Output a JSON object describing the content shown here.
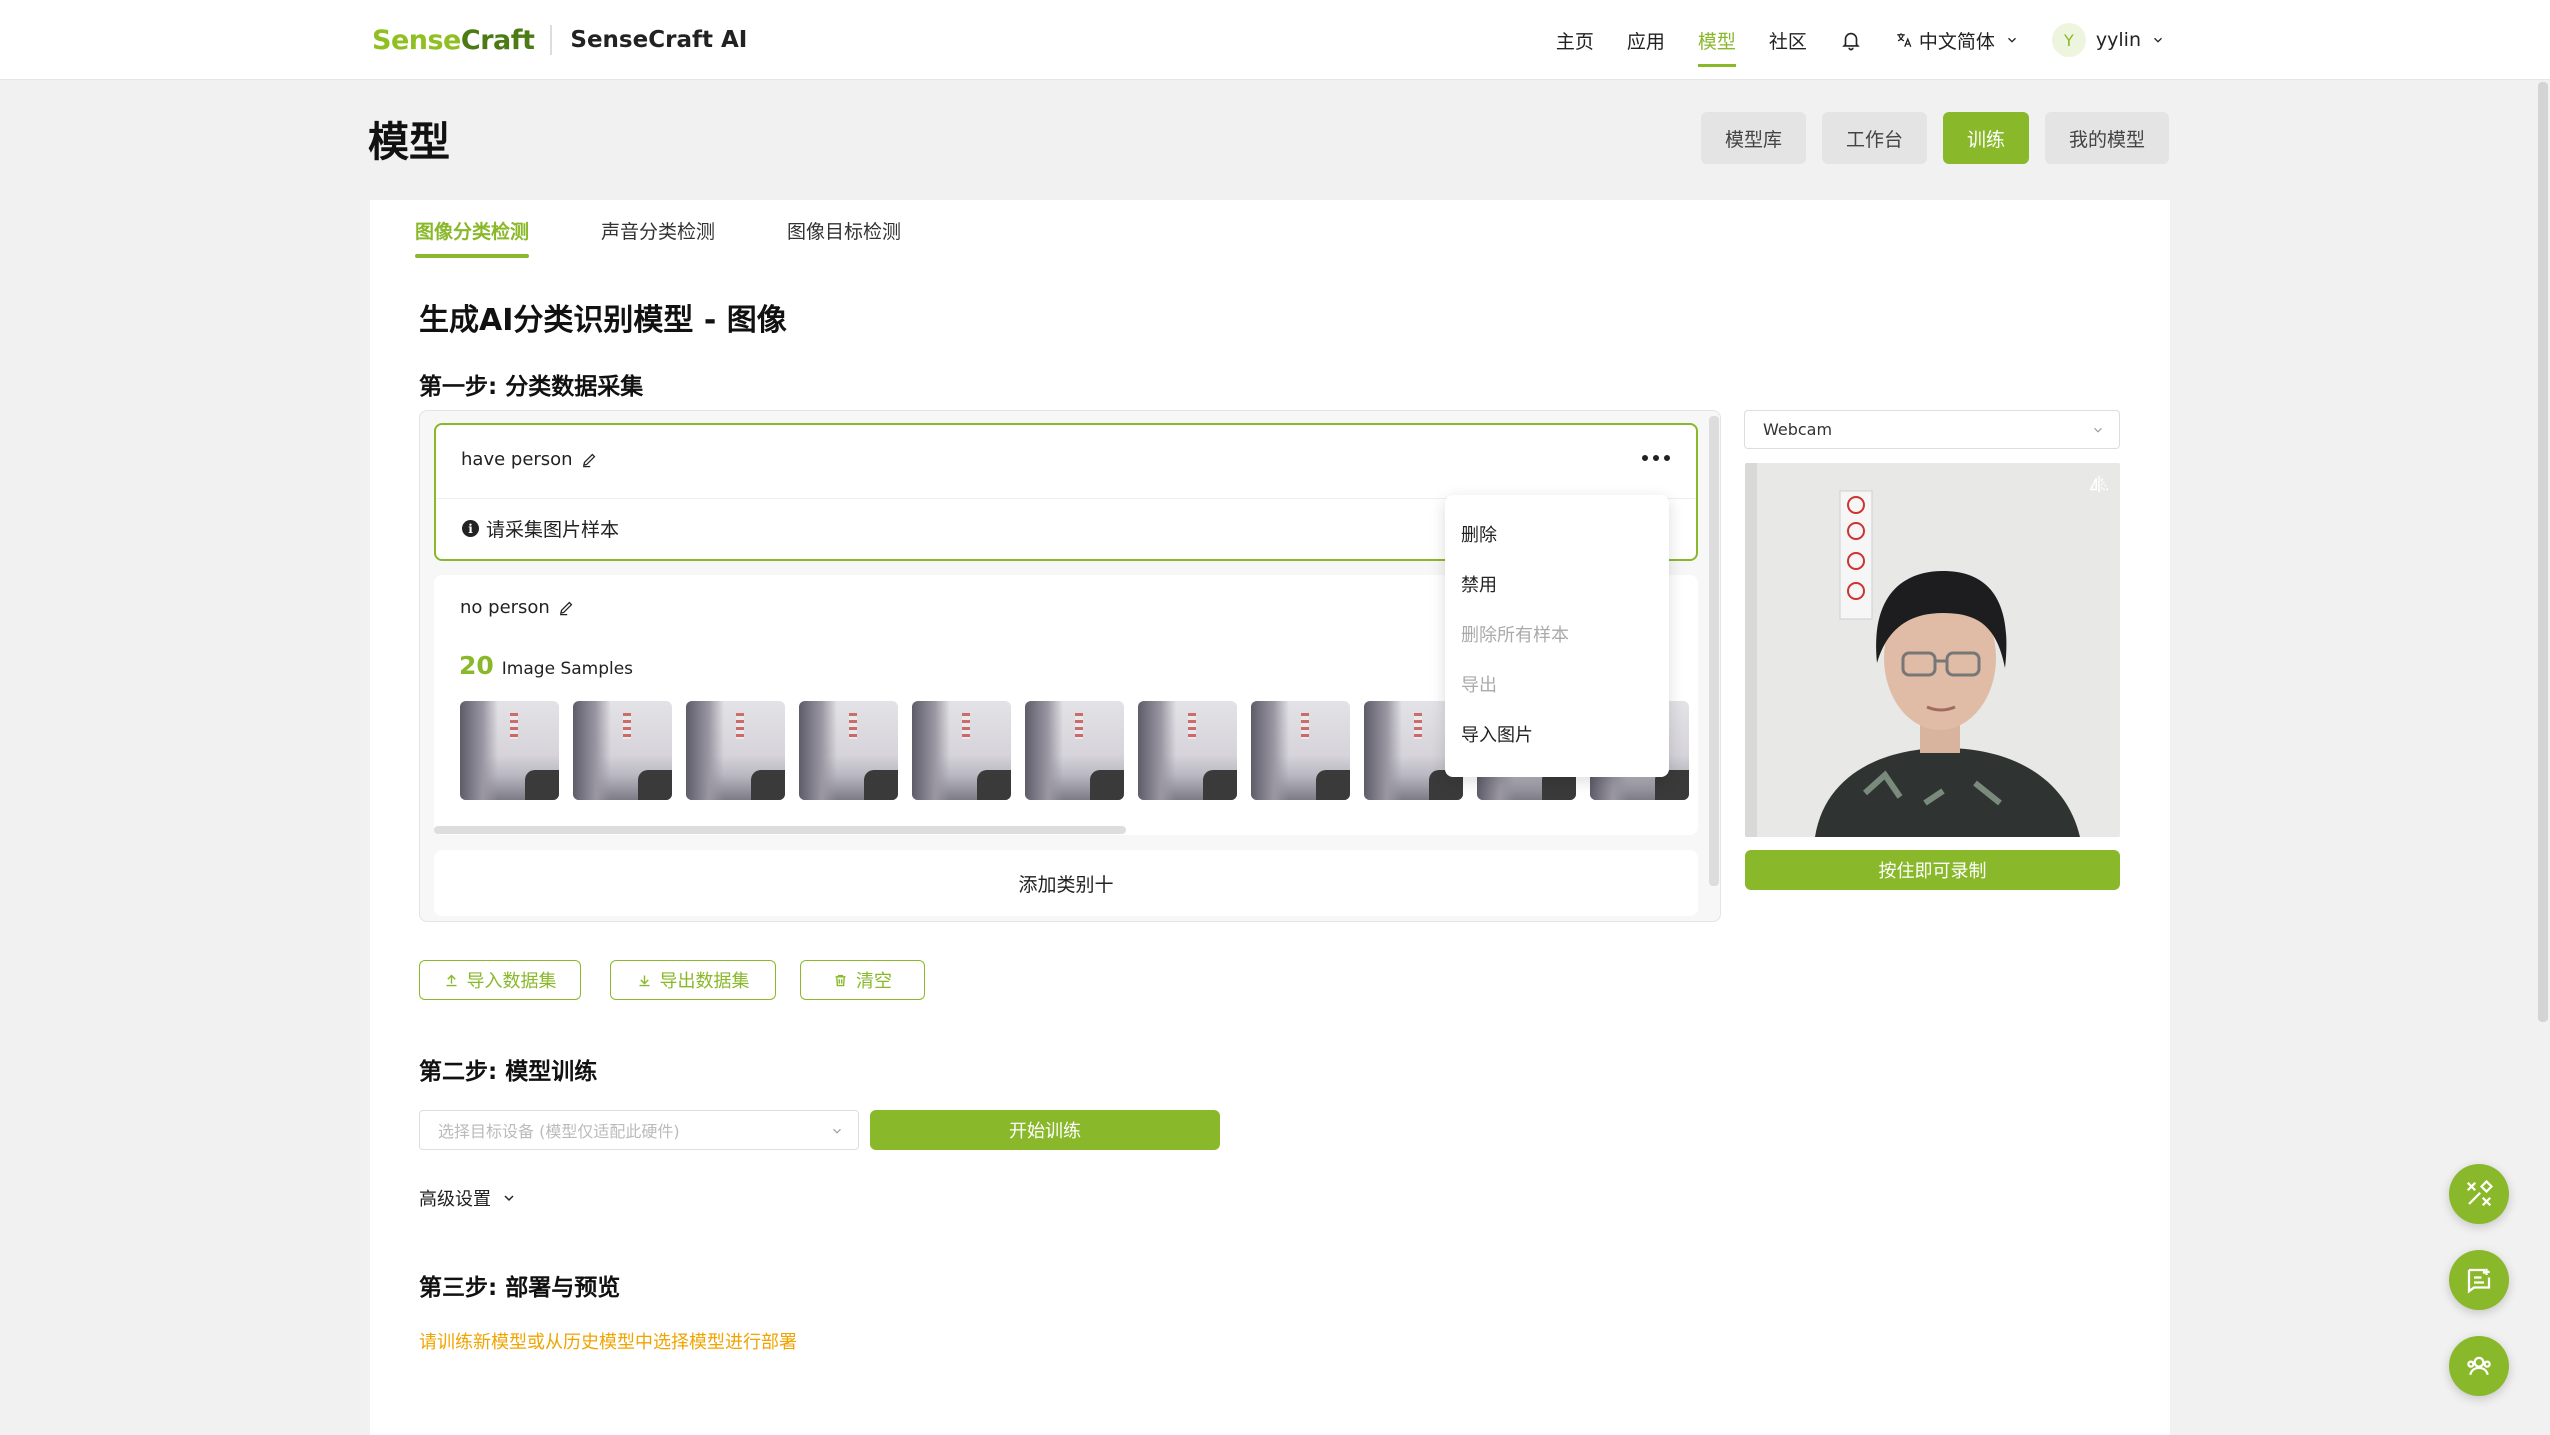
{
  "header": {
    "logo": {
      "part1": "Sense",
      "part2": "Craft"
    },
    "app_name": "SenseCraft AI",
    "nav": [
      "主页",
      "应用",
      "模型",
      "社区"
    ],
    "active_nav": "模型",
    "language": "中文简体",
    "user": {
      "initial": "Y",
      "name": "yylin"
    }
  },
  "page": {
    "title": "模型",
    "top_tabs": [
      "模型库",
      "工作台",
      "训练",
      "我的模型"
    ],
    "active_top_tab": "训练"
  },
  "subtabs": [
    "图像分类检测",
    "声音分类检测",
    "图像目标检测"
  ],
  "active_subtab": "图像分类检测",
  "main_heading": "生成AI分类识别模型 - 图像",
  "step1": {
    "title": "第一步: 分类数据采集",
    "classes": [
      {
        "name": "have person",
        "hint": "请采集图片样本"
      },
      {
        "name": "no person",
        "count": "20",
        "count_label": "Image Samples"
      }
    ],
    "add_class": "添加类别十",
    "context_menu": [
      "删除",
      "禁用",
      "删除所有样本",
      "导出",
      "导入图片"
    ],
    "webcam_select": "Webcam",
    "record_button": "按住即可录制",
    "import_dataset": "导入数据集",
    "export_dataset": "导出数据集",
    "clear": "清空"
  },
  "step2": {
    "title": "第二步: 模型训练",
    "device_placeholder": "选择目标设备 (模型仅适配此硬件)",
    "train_button": "开始训练",
    "advanced": "高级设置"
  },
  "step3": {
    "title": "第三步: 部署与预览",
    "warning": "请训练新模型或从历史模型中选择模型进行部署"
  },
  "colors": {
    "accent": "#8ab82b",
    "warning": "#f0a400"
  }
}
